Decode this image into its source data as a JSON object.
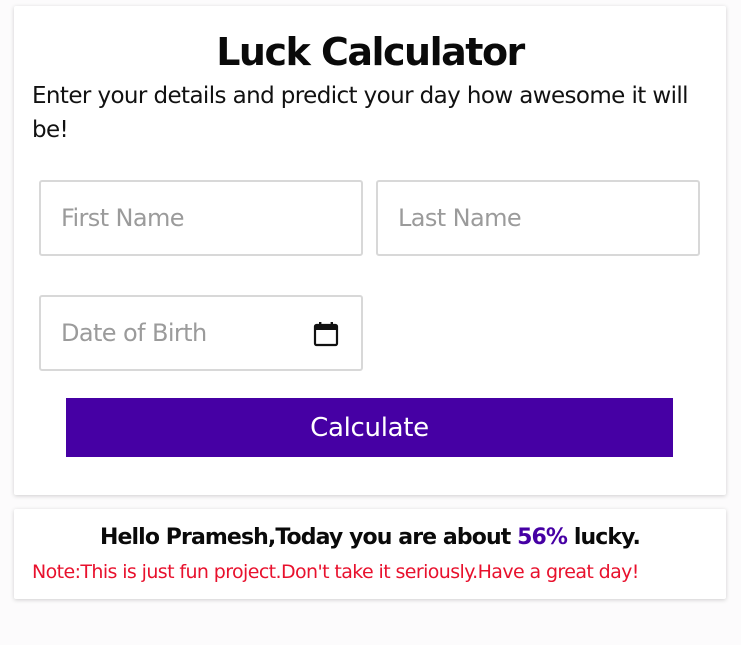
{
  "title": "Luck Calculator",
  "subtitle": "Enter your details and predict your day how awesome it will be!",
  "form": {
    "first_name_placeholder": "First Name",
    "last_name_placeholder": "Last Name",
    "dob_placeholder": "Date of Birth",
    "dob_icon": "calendar-icon",
    "calculate_label": "Calculate"
  },
  "result": {
    "prefix": "Hello Pramesh,Today you are about ",
    "percent": "56%",
    "suffix": " lucky.",
    "note": "Note:This is just fun project.Don't take it seriously.Have a great day!"
  },
  "colors": {
    "accent": "#4600a4",
    "note": "#e8112d"
  }
}
